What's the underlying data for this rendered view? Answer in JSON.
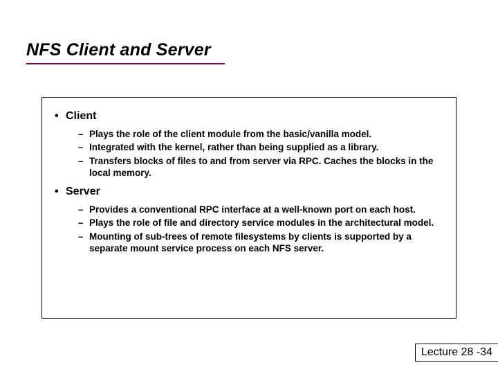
{
  "title": "NFS Client and Server",
  "sections": {
    "client": {
      "heading": "Client",
      "items": [
        "Plays the role of the client module from the basic/vanilla model.",
        "Integrated with the kernel, rather than being supplied as a library.",
        "Transfers blocks of files to and from server via RPC. Caches the blocks in the local memory."
      ]
    },
    "server": {
      "heading": "Server",
      "items": [
        "Provides a conventional RPC interface at a well-known port on each host.",
        "Plays the role of file and directory service modules in the architectural model.",
        "Mounting of sub-trees of remote filesystems by clients is supported by a separate mount service process on each NFS server."
      ]
    }
  },
  "footer": "Lecture 28 -34"
}
